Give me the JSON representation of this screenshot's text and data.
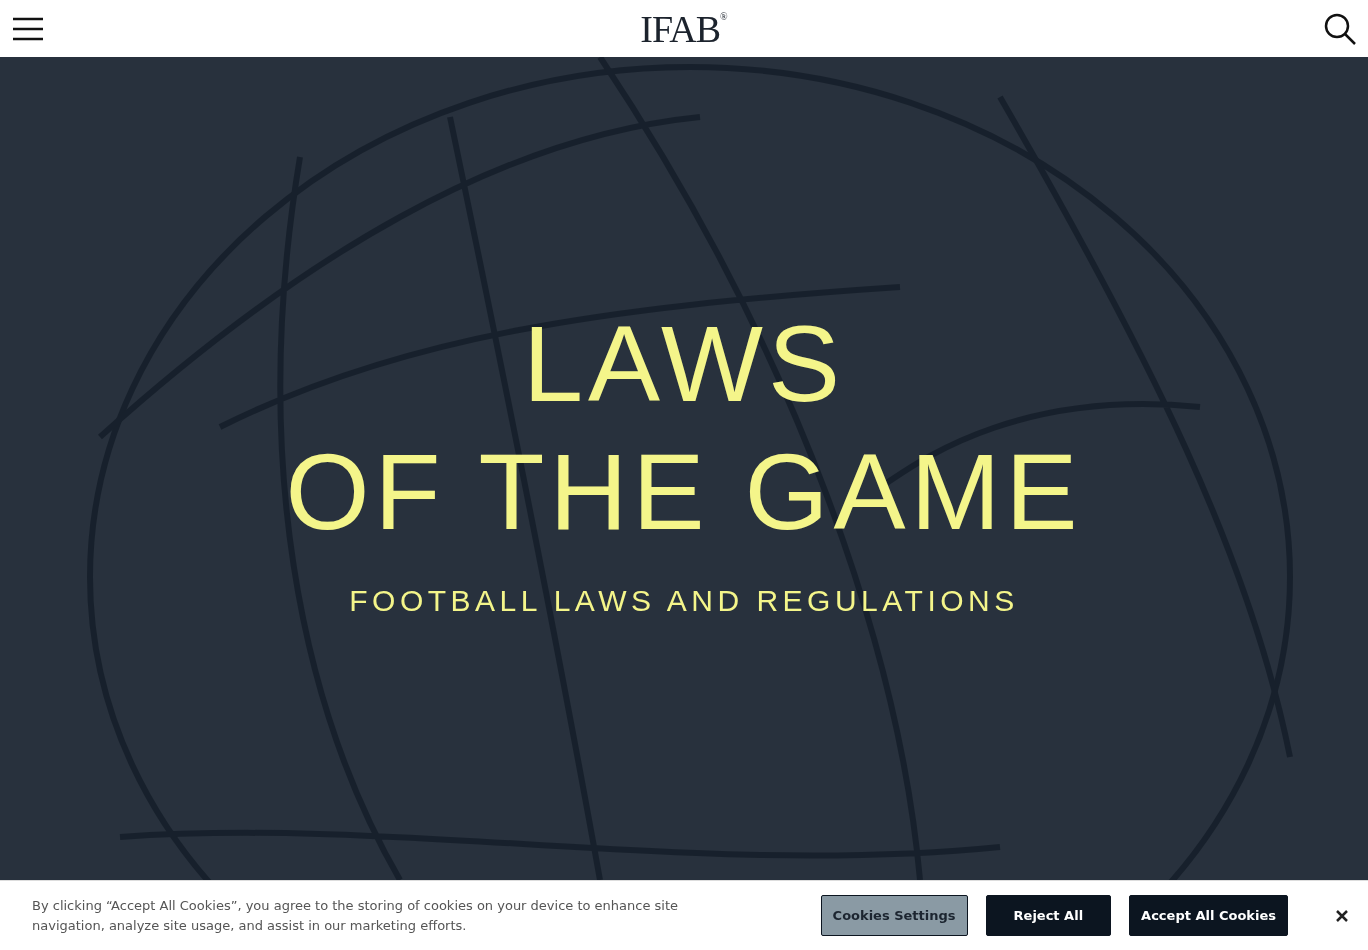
{
  "header": {
    "logo": "IFAB",
    "logo_mark": "®"
  },
  "hero": {
    "title_lines": [
      "LAWS",
      "OF THE GAME"
    ],
    "subtitle": "FOOTBALL LAWS AND REGULATIONS"
  },
  "cookie_banner": {
    "text": "By clicking “Accept All Cookies”, you agree to the storing of cookies on your device to enhance site navigation, analyze site usage, and assist in our marketing efforts.",
    "buttons": [
      {
        "label": "Cookies Settings",
        "kind": "secondary"
      },
      {
        "label": "Reject All",
        "kind": "primary"
      },
      {
        "label": "Accept All Cookies",
        "kind": "primary"
      }
    ]
  }
}
